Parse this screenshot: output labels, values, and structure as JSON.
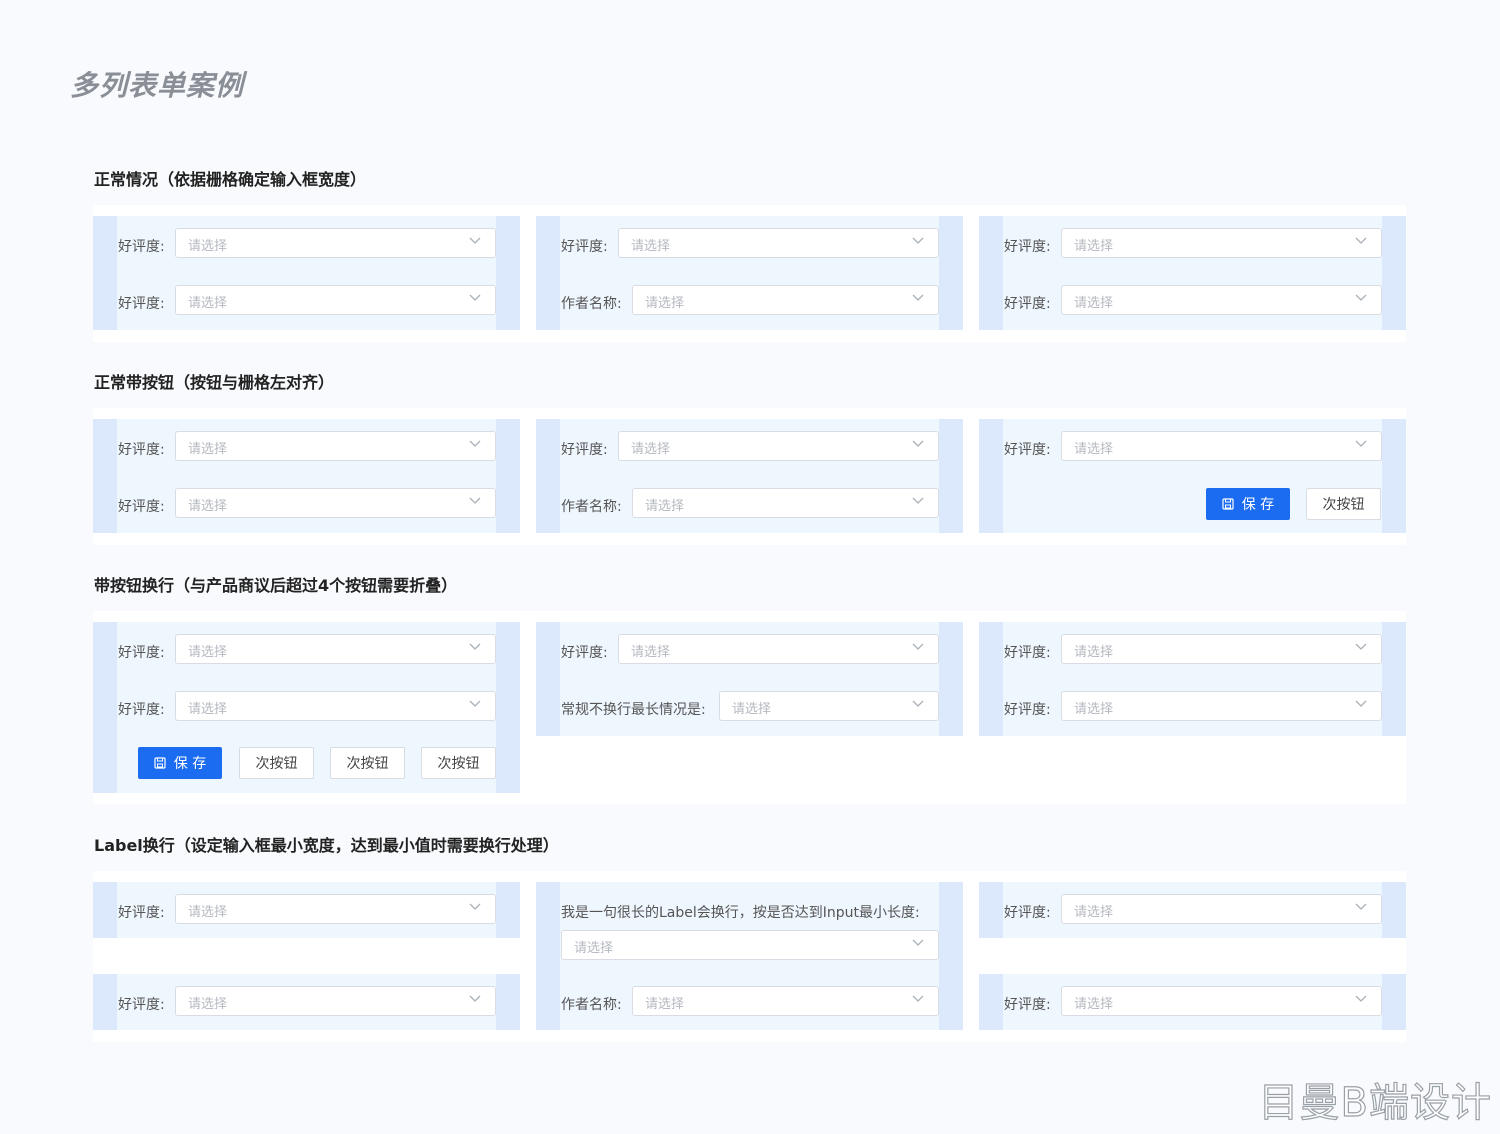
{
  "page": {
    "title": "多列表单案例"
  },
  "common": {
    "placeholder": "请选择",
    "label_rating": "好评度:",
    "label_author": "作者名称:"
  },
  "sections": [
    {
      "title": "正常情况（依据栅格确定输入框宽度）"
    },
    {
      "title": "正常带按钮（按钮与栅格左对齐）"
    },
    {
      "title": "带按钮换行（与产品商议后超过4个按钮需要折叠）"
    },
    {
      "title": "Label换行（设定输入框最小宽度，达到最小值时需要换行处理）"
    }
  ],
  "buttons": {
    "save": "保 存",
    "secondary": "次按钮"
  },
  "labels": {
    "long_label": "常规不换行最长情况是:",
    "wrap_label": "我是一句很长的Label会换行，按是否达到Input最小长度:"
  },
  "colors": {
    "primary": "#1b6cf0",
    "column_border": "#dce8fb",
    "column_fill": "#eef6fe"
  },
  "watermark": "目曼B端设计"
}
